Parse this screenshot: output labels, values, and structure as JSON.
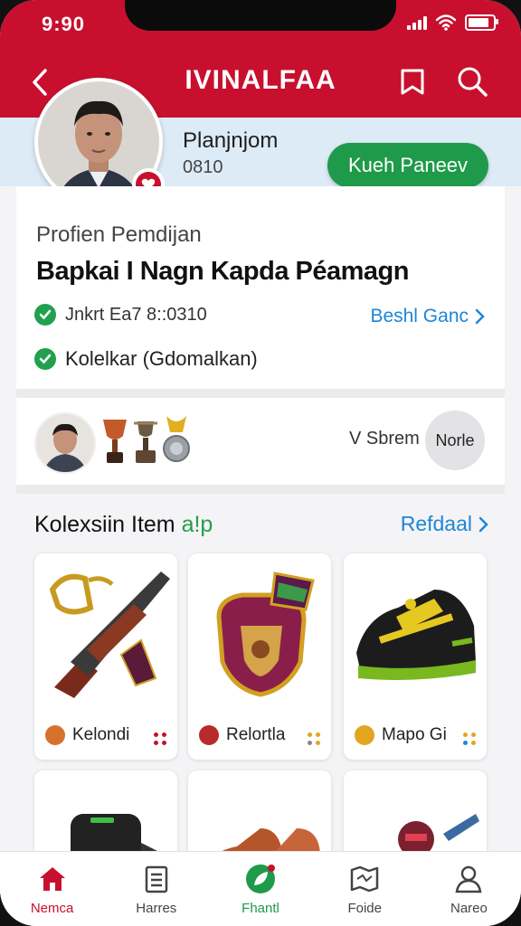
{
  "status": {
    "time": "9:90"
  },
  "header": {
    "title": "IVINALFAA"
  },
  "profile": {
    "name": "Planjnjom",
    "id": "0810",
    "action_label": "Kueh Paneev"
  },
  "info": {
    "section_label": "Profien Pemdijan",
    "title": "Bapkai I Nagn Kapda Péamagn",
    "row1_text": "Jnkrt Ea7 8::0310",
    "row1_link": "Beshl Ganc",
    "row2_text": "Kolelkar (Gdomalkan)"
  },
  "friends": {
    "text": "V Sbrem",
    "more_label": "Norle"
  },
  "collection": {
    "title_main": "Kolexsiin Item",
    "title_accent": "a!p",
    "link": "Refdaal",
    "items": [
      {
        "label": "Kelondi",
        "coin_color": "#d7722e"
      },
      {
        "label": "Relortla",
        "coin_color": "#b92a2a"
      },
      {
        "label": "Mapo Gi",
        "coin_color": "#e2a520"
      }
    ]
  },
  "nav": {
    "items": [
      {
        "label": "Nemca"
      },
      {
        "label": "Harres"
      },
      {
        "label": "Fhantl"
      },
      {
        "label": "Foide"
      },
      {
        "label": "Nareo"
      }
    ]
  },
  "colors": {
    "brand": "#c8102e",
    "accent": "#1f9a4a",
    "link": "#1d86d6"
  }
}
